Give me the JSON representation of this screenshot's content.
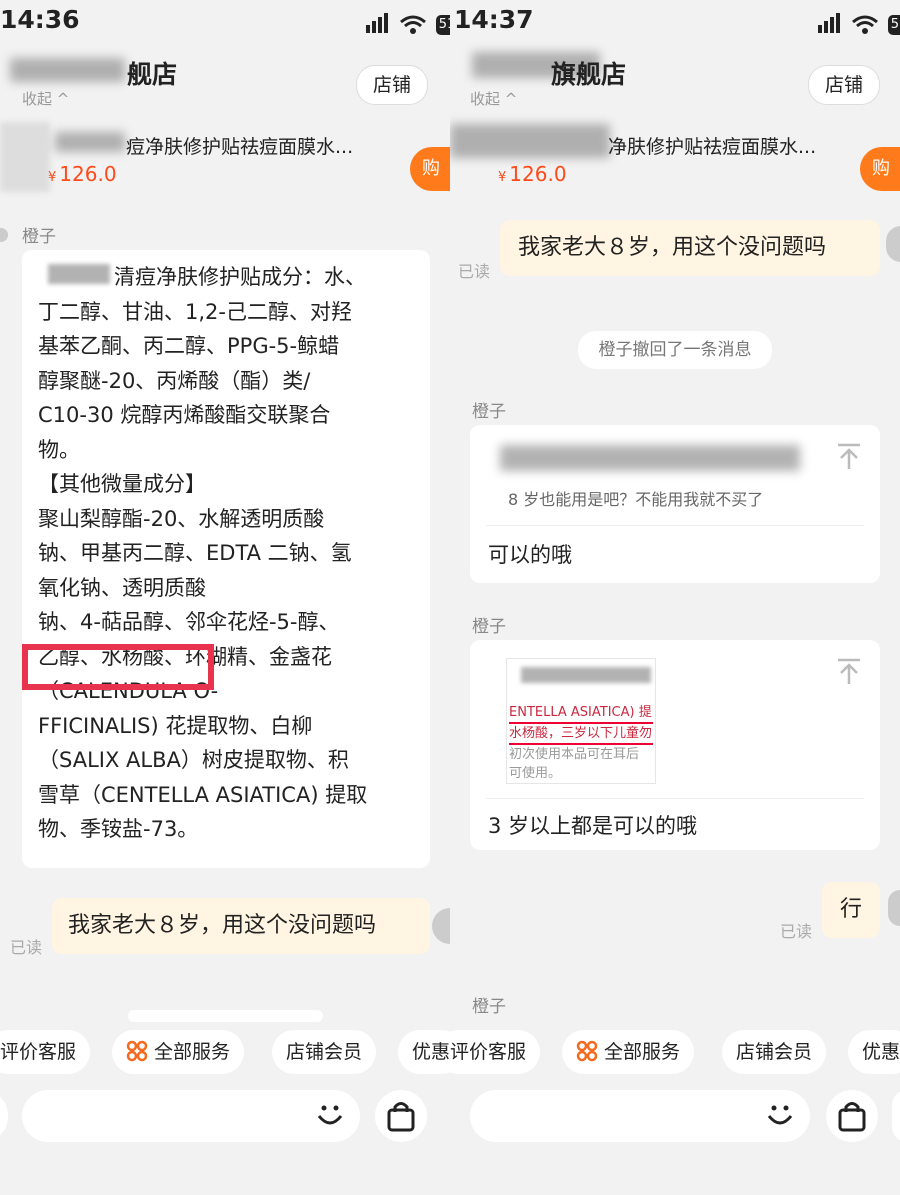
{
  "left": {
    "time": "14:36",
    "battery": "51",
    "shop_name_suffix": "舰店",
    "collapse": "收起 ^",
    "shop_button": "店铺",
    "product_title": "痘净肤修护贴祛痘面膜水...",
    "currency": "¥",
    "price": "126.0",
    "buy": "购",
    "sender": "橙子",
    "ingredient_lines": [
      "清痘净肤修护贴成分：水、",
      "丁二醇、甘油、1,2-己二醇、对羟",
      "基苯乙酮、丙二醇、PPG-5-鲸蜡",
      "醇聚醚-20、丙烯酸（酯）类/",
      "C10-30 烷醇丙烯酸酯交联聚合",
      "物。",
      "【其他微量成分】",
      "聚山梨醇酯-20、水解透明质酸",
      "钠、甲基丙二醇、EDTA 二钠、氢",
      "氧化钠、透明质酸",
      "钠、4-萜品醇、邻伞花烃-5-醇、",
      "乙醇、水杨酸、环糊精、金盏花",
      "（CALENDULA O-",
      "FFICINALIS) 花提取物、白柳",
      "（SALIX ALBA）树皮提取物、积",
      "雪草（CENTELLA ASIATICA) 提取",
      "物、季铵盐-73。"
    ],
    "my_message": "我家老大８岁，用这个没问题吗",
    "read": "已读",
    "tabs": [
      "评价客服",
      "全部服务",
      "店铺会员",
      "优惠"
    ]
  },
  "right": {
    "time": "14:37",
    "battery": "51",
    "shop_name_suffix": "旗舰店",
    "collapse": "收起 ^",
    "shop_button": "店铺",
    "product_title": "净肤修护贴祛痘面膜水...",
    "currency": "¥",
    "price": "126.0",
    "buy": "购",
    "my_message": "我家老大８岁，用这个没问题吗",
    "read_1": "已读",
    "recall_notice": "橙子撤回了一条消息",
    "sender_1": "橙子",
    "quote_text": "8 岁也能用是吧？不能用我就不买了",
    "reply_1": "可以的哦",
    "sender_2": "橙子",
    "image_lines": [
      "ENTELLA ASIATICA) 提",
      "水杨酸，三岁以下儿童勿",
      "初次使用本品可在耳后",
      "可使用。"
    ],
    "reply_2": "3 岁以上都是可以的哦",
    "my_message_2": "行",
    "read_2": "已读",
    "sender_3": "橙子",
    "tabs": [
      "评价客服",
      "全部服务",
      "店铺会员",
      "优惠"
    ]
  }
}
